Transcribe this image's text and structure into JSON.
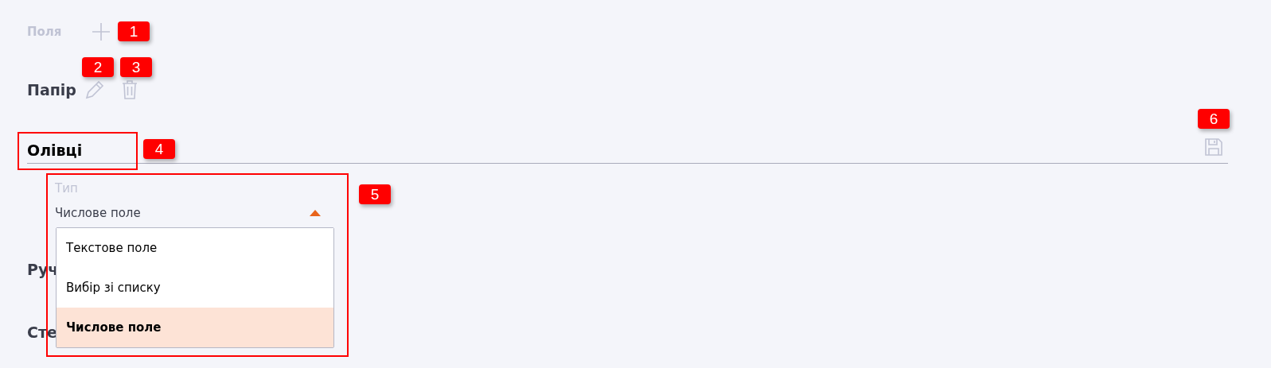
{
  "fields_header": {
    "title": "Поля"
  },
  "sections": [
    {
      "title": "Папір",
      "kind": "editable"
    },
    {
      "title": "Олівці",
      "kind": "open"
    }
  ],
  "type_select": {
    "label": "Тип",
    "value": "Числове поле",
    "expanded": true,
    "options": [
      {
        "label": "Текстове поле",
        "selected": false
      },
      {
        "label": "Вибір зі списку",
        "selected": false
      },
      {
        "label": "Числове поле",
        "selected": true
      }
    ]
  },
  "hidden_sections": [
    {
      "title": "Руч"
    },
    {
      "title": "Сте"
    }
  ],
  "annotations": [
    {
      "number": "1",
      "kind": "badge"
    },
    {
      "number": "2",
      "kind": "badge"
    },
    {
      "number": "3",
      "kind": "badge"
    },
    {
      "number": "4",
      "kind": "boxed"
    },
    {
      "number": "5",
      "kind": "boxed"
    },
    {
      "number": "6",
      "kind": "badge"
    }
  ]
}
